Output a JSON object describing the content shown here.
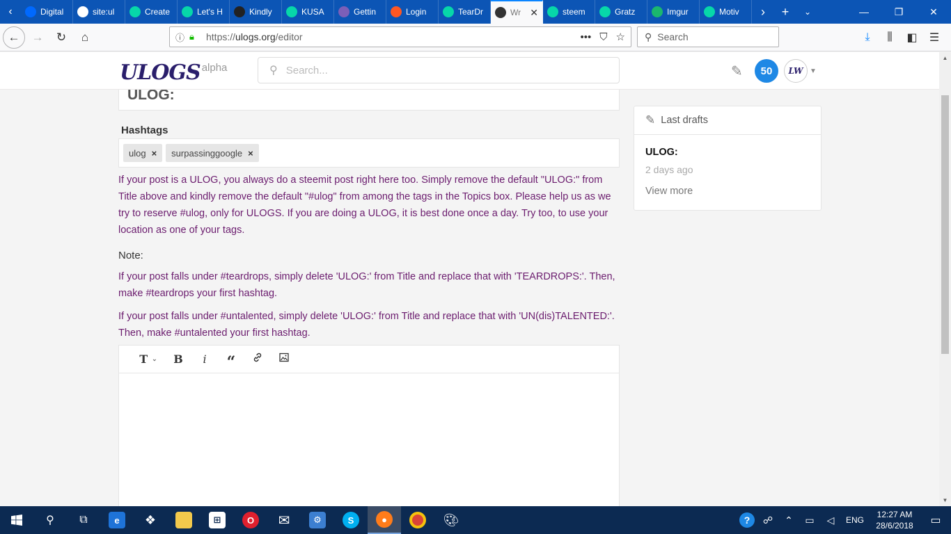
{
  "browser": {
    "tabs": [
      {
        "label": "Digital",
        "icon": "digitalocean-icon",
        "color": "#0069ff"
      },
      {
        "label": "site:ul",
        "icon": "google-icon",
        "color": "#ffffff"
      },
      {
        "label": "Create",
        "icon": "steemit-icon",
        "color": "#07d7a9"
      },
      {
        "label": "Let's H",
        "icon": "steemit-icon",
        "color": "#07d7a9"
      },
      {
        "label": "Kindly",
        "icon": "github-icon",
        "color": "#222222"
      },
      {
        "label": "KUSA",
        "icon": "steemit-icon",
        "color": "#07d7a9"
      },
      {
        "label": "Gettin",
        "icon": "h-icon",
        "color": "#7b5fb8"
      },
      {
        "label": "Login",
        "icon": "n-icon",
        "color": "#ff5722"
      },
      {
        "label": "TearDr",
        "icon": "steemit-icon",
        "color": "#07d7a9"
      },
      {
        "label": "Wr",
        "icon": "bolt-icon",
        "color": "#333333",
        "active": true
      },
      {
        "label": "steem",
        "icon": "steemit-icon",
        "color": "#07d7a9"
      },
      {
        "label": "Gratz",
        "icon": "steemit-icon",
        "color": "#07d7a9"
      },
      {
        "label": "Imgur",
        "icon": "imgur-icon",
        "color": "#1bb76e"
      },
      {
        "label": "Motiv",
        "icon": "steemit-icon",
        "color": "#07d7a9"
      }
    ],
    "url": {
      "prefix": "https://",
      "host": "ulogs.org",
      "path": "/editor"
    },
    "search_placeholder": "Search"
  },
  "site": {
    "logo_text": "ULOGS",
    "logo_suffix": "alpha",
    "search_placeholder": "Search...",
    "notification_count": "50",
    "avatar_text": "LW"
  },
  "editor": {
    "title_value": "ULOG:",
    "hashtags_label": "Hashtags",
    "tags": [
      "ulog",
      "surpassinggoogle"
    ],
    "remove_glyph": "×",
    "info_paragraph": "If your post is a ULOG, you always do a steemit post right here too. Simply remove the default \"ULOG:\" from Title above and kindly remove the default \"#ulog\" from among the tags in the Topics box. Please help us as we try to reserve #ulog, only for ULOGS. If you are doing a ULOG, it is best done once a day. Try too, to use your location as one of your tags.",
    "note_label": "Note:",
    "teardrops_note": "If your post falls under #teardrops, simply delete 'ULOG:' from Title and replace that with 'TEARDROPS:'. Then, make #teardrops your first hashtag.",
    "untalented_note": "If your post falls under #untalented, simply delete 'ULOG:' from Title and replace that with 'UN(dis)TALENTED:'. Then, make #untalented your first hashtag.",
    "toolbar": {
      "heading": "T",
      "bold": "B",
      "italic": "i",
      "quote": "“"
    }
  },
  "sidebar": {
    "drafts_title": "Last drafts",
    "draft_title": "ULOG:",
    "draft_time": "2 days ago",
    "view_more": "View more"
  },
  "taskbar": {
    "language": "ENG",
    "time": "12:27 AM",
    "date": "28/6/2018"
  },
  "colors": {
    "info_text": "#6b1c6e",
    "badge": "#1e88e5",
    "tab_strip": "#0c55b5",
    "taskbar": "#0c2a52"
  }
}
